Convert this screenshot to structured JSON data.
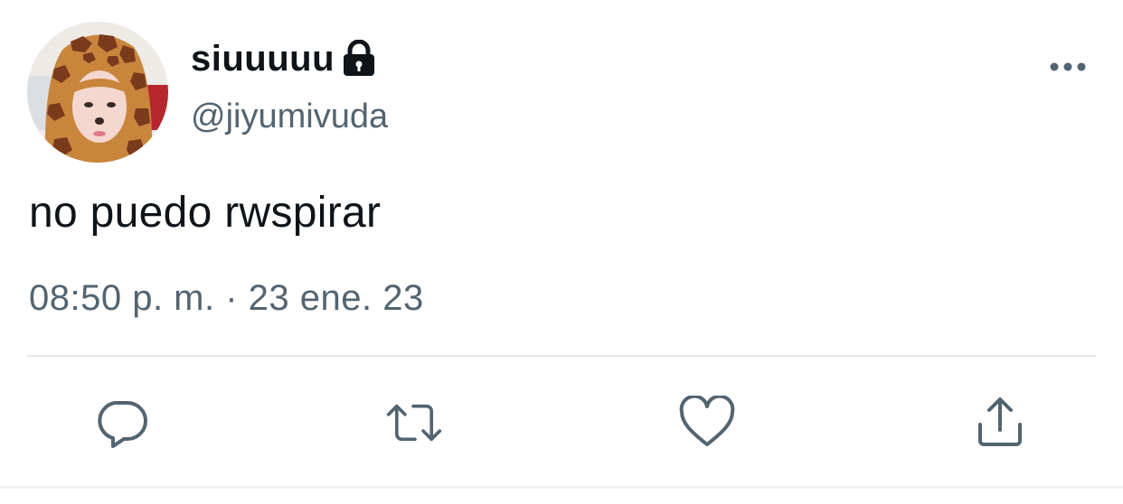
{
  "author": {
    "display_name": "siuuuuu",
    "handle": "@jiyumivuda",
    "protected_icon": "lock-icon",
    "avatar_icon": "profile-photo"
  },
  "tweet": {
    "text": "no puedo rwspirar",
    "timestamp": "08:50 p. m. · 23 ene. 23"
  },
  "actions": [
    {
      "name": "reply",
      "icon": "reply-icon"
    },
    {
      "name": "retweet",
      "icon": "retweet-icon"
    },
    {
      "name": "like",
      "icon": "heart-icon"
    },
    {
      "name": "share",
      "icon": "share-icon"
    }
  ],
  "menu": {
    "icon": "more-icon"
  },
  "colors": {
    "text_primary": "#0f1419",
    "text_secondary": "#536471",
    "icon": "#536471",
    "divider": "#e4e8eb"
  }
}
